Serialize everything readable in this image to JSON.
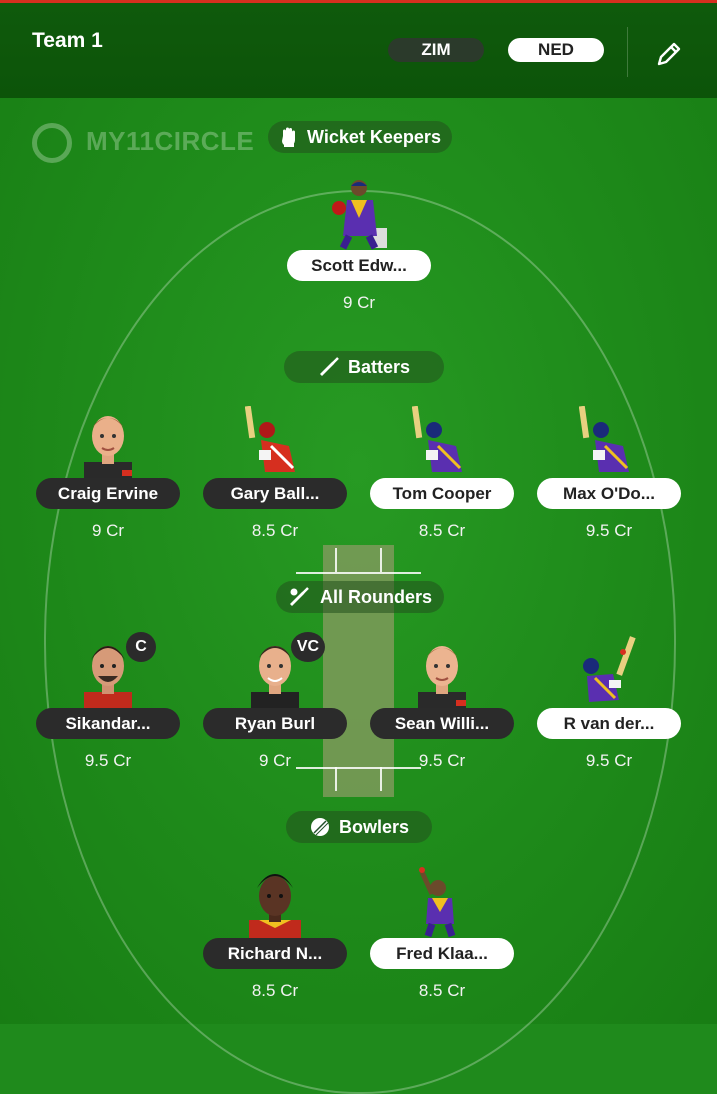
{
  "header": {
    "title": "Team 1",
    "teams": [
      "ZIM",
      "NED"
    ],
    "edit_icon": "pencil-icon"
  },
  "branding": {
    "logo_text": "MY11CIRCLE"
  },
  "colors": {
    "header_bg": "#0c5409",
    "field_green": "#1f8a1c",
    "zim_pill": "#2b3a2b",
    "ned_pill": "#ffffff",
    "accent_red": "#d62f1f"
  },
  "sections": {
    "wicket_keepers": {
      "label": "Wicket Keepers",
      "icon": "glove-icon"
    },
    "batters": {
      "label": "Batters",
      "icon": "bat-icon"
    },
    "all_rounders": {
      "label": "All Rounders",
      "icon": "bat-ball-icon"
    },
    "bowlers": {
      "label": "Bowlers",
      "icon": "ball-icon"
    }
  },
  "players": {
    "wk": [
      {
        "name": "Scott Edw...",
        "credits": "9 Cr",
        "team": "NED"
      }
    ],
    "bat": [
      {
        "name": "Craig Ervine",
        "credits": "9 Cr",
        "team": "ZIM"
      },
      {
        "name": "Gary Ball...",
        "credits": "8.5 Cr",
        "team": "ZIM"
      },
      {
        "name": "Tom Cooper",
        "credits": "8.5 Cr",
        "team": "NED"
      },
      {
        "name": "Max O'Do...",
        "credits": "9.5 Cr",
        "team": "NED"
      }
    ],
    "ar": [
      {
        "name": "Sikandar...",
        "credits": "9.5 Cr",
        "team": "ZIM",
        "badge": "C"
      },
      {
        "name": "Ryan Burl",
        "credits": "9 Cr",
        "team": "ZIM",
        "badge": "VC"
      },
      {
        "name": "Sean Willi...",
        "credits": "9.5 Cr",
        "team": "ZIM"
      },
      {
        "name": "R van der...",
        "credits": "9.5 Cr",
        "team": "NED"
      }
    ],
    "bowl": [
      {
        "name": "Richard N...",
        "credits": "8.5 Cr",
        "team": "ZIM"
      },
      {
        "name": "Fred Klaa...",
        "credits": "8.5 Cr",
        "team": "NED"
      }
    ]
  }
}
